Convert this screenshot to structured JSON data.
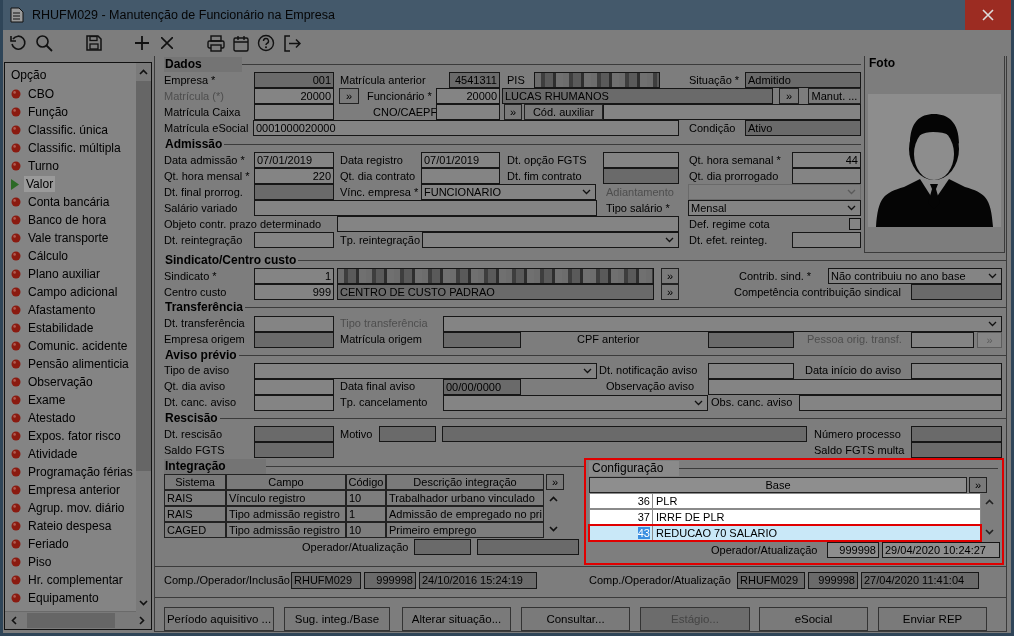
{
  "window": {
    "title": "RHUFM029 - Manutenção de Funcionário na Empresa"
  },
  "sidebar": {
    "title": "Opção",
    "items": [
      {
        "label": "CBO",
        "selected": false
      },
      {
        "label": "Função",
        "selected": false
      },
      {
        "label": "Classific. única",
        "selected": false
      },
      {
        "label": "Classific. múltipla",
        "selected": false
      },
      {
        "label": "Turno",
        "selected": false
      },
      {
        "label": "Valor",
        "selected": true
      },
      {
        "label": "Conta bancária",
        "selected": false
      },
      {
        "label": "Banco de hora",
        "selected": false
      },
      {
        "label": "Vale transporte",
        "selected": false
      },
      {
        "label": "Cálculo",
        "selected": false
      },
      {
        "label": "Plano auxiliar",
        "selected": false
      },
      {
        "label": "Campo adicional",
        "selected": false
      },
      {
        "label": "Afastamento",
        "selected": false
      },
      {
        "label": "Estabilidade",
        "selected": false
      },
      {
        "label": "Comunic. acidente",
        "selected": false
      },
      {
        "label": "Pensão alimenticia",
        "selected": false
      },
      {
        "label": "Observação",
        "selected": false
      },
      {
        "label": "Exame",
        "selected": false
      },
      {
        "label": "Atestado",
        "selected": false
      },
      {
        "label": "Expos. fator risco",
        "selected": false
      },
      {
        "label": "Atividade",
        "selected": false
      },
      {
        "label": "Programação férias",
        "selected": false
      },
      {
        "label": "Empresa anterior",
        "selected": false
      },
      {
        "label": "Agrup. mov. diário",
        "selected": false
      },
      {
        "label": "Rateio despesa",
        "selected": false
      },
      {
        "label": "Feriado",
        "selected": false
      },
      {
        "label": "Piso",
        "selected": false
      },
      {
        "label": "Hr. complementar",
        "selected": false
      },
      {
        "label": "Equipamento",
        "selected": false
      }
    ]
  },
  "sections": [
    {
      "title": "Dados",
      "lines": [
        {
          "items": [
            {
              "kind": "label",
              "text": "Empresa *",
              "disabled": false
            },
            {
              "kind": "number",
              "value": "001",
              "disabled": true
            },
            {
              "kind": "label",
              "text": "Matrícula anterior",
              "disabled": false
            },
            {
              "kind": "number",
              "value": "4541311",
              "disabled": true
            },
            {
              "kind": "label",
              "text": "PIS",
              "disabled": false
            },
            {
              "kind": "redacted"
            },
            {
              "kind": "label",
              "text": "Situação *",
              "disabled": false
            },
            {
              "kind": "field",
              "value": "Admitido",
              "disabled": true
            }
          ]
        },
        {
          "items": [
            {
              "kind": "label",
              "text": "Matrícula (*)",
              "disabled": true
            },
            {
              "kind": "number",
              "value": "20000",
              "disabled": false
            },
            {
              "kind": "button",
              "text": "»",
              "disabled": false
            },
            {
              "kind": "label",
              "text": "Funcionário *",
              "disabled": false
            },
            {
              "kind": "number",
              "value": "20000",
              "disabled": false
            },
            {
              "kind": "field",
              "value": "LUCAS RHUMANOS",
              "disabled": true
            },
            {
              "kind": "button",
              "text": "»",
              "disabled": false
            },
            {
              "kind": "button",
              "text": "Manut. ...",
              "disabled": false
            }
          ]
        },
        {
          "items": [
            {
              "kind": "label",
              "text": "Matrícula Caixa",
              "disabled": false
            },
            {
              "kind": "field",
              "disabled": false
            },
            {
              "kind": "label",
              "text": "CNO/CAEPF",
              "disabled": false
            },
            {
              "kind": "field",
              "disabled": false
            },
            {
              "kind": "button",
              "text": "»",
              "disabled": false
            },
            {
              "kind": "button",
              "text": "Cód. auxiliar",
              "disabled": false
            },
            {
              "kind": "field",
              "disabled": false
            }
          ]
        },
        {
          "items": [
            {
              "kind": "label",
              "text": "Matrícula eSocial",
              "disabled": false
            },
            {
              "kind": "field",
              "value": "0001000020000",
              "disabled": false
            },
            {
              "kind": "label",
              "text": "Condição",
              "disabled": false
            },
            {
              "kind": "field",
              "value": "Ativo",
              "disabled": true
            }
          ]
        }
      ]
    },
    {
      "title": "Admissão",
      "lines": [
        {
          "items": [
            {
              "kind": "label",
              "text": "Data admissão *",
              "disabled": false
            },
            {
              "kind": "field",
              "value": "07/01/2019",
              "disabled": false
            },
            {
              "kind": "label",
              "text": "Data registro",
              "disabled": false
            },
            {
              "kind": "field",
              "value": "07/01/2019",
              "disabled": false
            },
            {
              "kind": "label",
              "text": "Dt. opção FGTS",
              "disabled": false
            },
            {
              "kind": "field",
              "disabled": false
            },
            {
              "kind": "label",
              "text": "Qt. hora semanal *",
              "disabled": false
            },
            {
              "kind": "number",
              "value": "44",
              "disabled": false
            }
          ]
        },
        {
          "items": [
            {
              "kind": "label",
              "text": "Qt. hora mensal *",
              "disabled": false
            },
            {
              "kind": "number",
              "value": "220",
              "disabled": false
            },
            {
              "kind": "label",
              "text": "Qt. dia contrato",
              "disabled": false
            },
            {
              "kind": "field",
              "disabled": false
            },
            {
              "kind": "label",
              "text": "Dt. fim contrato",
              "disabled": false
            },
            {
              "kind": "field",
              "disabled": true
            },
            {
              "kind": "label",
              "text": "Qt. dia prorrogado",
              "disabled": false
            },
            {
              "kind": "field",
              "disabled": false
            }
          ]
        },
        {
          "items": [
            {
              "kind": "label",
              "text": "Dt. final prorrog.",
              "disabled": false
            },
            {
              "kind": "field",
              "disabled": true
            },
            {
              "kind": "label",
              "text": "Vínc. empresa *",
              "disabled": false
            },
            {
              "kind": "combo",
              "value": "FUNCIONARIO",
              "disabled": false
            },
            {
              "kind": "label",
              "text": "Adiantamento",
              "disabled": true
            },
            {
              "kind": "combo",
              "disabled": true
            }
          ]
        },
        {
          "items": [
            {
              "kind": "label",
              "text": "Salário variado",
              "disabled": false
            },
            {
              "kind": "field",
              "disabled": false
            },
            {
              "kind": "label",
              "text": "Tipo salário *",
              "disabled": false
            },
            {
              "kind": "combo",
              "value": "Mensal",
              "disabled": false
            }
          ]
        },
        {
          "items": [
            {
              "kind": "label",
              "text": "Objeto contr. prazo determinado",
              "disabled": false
            },
            {
              "kind": "field",
              "disabled": false
            },
            {
              "kind": "label",
              "text": "Def. regime cota",
              "disabled": false
            },
            {
              "kind": "checkbox",
              "checked": false
            }
          ]
        },
        {
          "items": [
            {
              "kind": "label",
              "text": "Dt. reintegração",
              "disabled": false
            },
            {
              "kind": "field",
              "disabled": false
            },
            {
              "kind": "label",
              "text": "Tp. reintegração",
              "disabled": false
            },
            {
              "kind": "combo",
              "disabled": false
            },
            {
              "kind": "label",
              "text": "Dt. efet. reinteg.",
              "disabled": false
            },
            {
              "kind": "field",
              "disabled": false
            }
          ]
        }
      ]
    },
    {
      "title": "Sindicato/Centro custo",
      "lines": [
        {
          "items": [
            {
              "kind": "label",
              "text": "Sindicato *",
              "disabled": false
            },
            {
              "kind": "number",
              "value": "1",
              "disabled": false
            },
            {
              "kind": "redacted"
            },
            {
              "kind": "button",
              "text": "»",
              "disabled": false
            },
            {
              "kind": "label",
              "text": "Contrib. sind. *",
              "disabled": false
            },
            {
              "kind": "combo",
              "value": "Não contribuiu no ano base",
              "disabled": false
            }
          ]
        },
        {
          "items": [
            {
              "kind": "label",
              "text": "Centro custo",
              "disabled": false
            },
            {
              "kind": "number",
              "value": "999",
              "disabled": false
            },
            {
              "kind": "field",
              "value": "CENTRO DE CUSTO PADRAO",
              "disabled": true
            },
            {
              "kind": "button",
              "text": "»",
              "disabled": false
            },
            {
              "kind": "label",
              "text": "Competência contribuição sindical",
              "disabled": false
            },
            {
              "kind": "field",
              "disabled": true
            }
          ]
        }
      ]
    },
    {
      "title": "Transferência",
      "lines": [
        {
          "items": [
            {
              "kind": "label",
              "text": "Dt. transferência",
              "disabled": false
            },
            {
              "kind": "field",
              "disabled": false
            },
            {
              "kind": "label",
              "text": "Tipo transferência",
              "disabled": true
            },
            {
              "kind": "combo",
              "disabled": false
            }
          ]
        },
        {
          "items": [
            {
              "kind": "label",
              "text": "Empresa origem",
              "disabled": false
            },
            {
              "kind": "field",
              "disabled": true
            },
            {
              "kind": "label",
              "text": "Matrícula origem",
              "disabled": false
            },
            {
              "kind": "field",
              "disabled": true
            },
            {
              "kind": "label",
              "text": "CPF anterior",
              "disabled": false
            },
            {
              "kind": "field",
              "disabled": true
            },
            {
              "kind": "label",
              "text": "Pessoa orig. transf.",
              "disabled": true
            },
            {
              "kind": "field",
              "disabled": false
            },
            {
              "kind": "button",
              "text": "»",
              "disabled": true
            }
          ]
        }
      ]
    },
    {
      "title": "Aviso prévio",
      "lines": [
        {
          "items": [
            {
              "kind": "label",
              "text": "Tipo de aviso",
              "disabled": false
            },
            {
              "kind": "combo",
              "disabled": false
            },
            {
              "kind": "label",
              "text": "Dt. notificação aviso",
              "disabled": false
            },
            {
              "kind": "field",
              "disabled": false
            },
            {
              "kind": "label",
              "text": "Data início do aviso",
              "disabled": false
            },
            {
              "kind": "field",
              "disabled": false
            }
          ]
        },
        {
          "items": [
            {
              "kind": "label",
              "text": "Qt. dia aviso",
              "disabled": false
            },
            {
              "kind": "field",
              "disabled": false
            },
            {
              "kind": "label",
              "text": "Data final aviso",
              "disabled": false
            },
            {
              "kind": "field",
              "value": "00/00/0000",
              "disabled": true
            },
            {
              "kind": "label",
              "text": "Observação aviso",
              "disabled": false
            },
            {
              "kind": "field",
              "disabled": false
            }
          ]
        },
        {
          "items": [
            {
              "kind": "label",
              "text": "Dt. canc. aviso",
              "disabled": false
            },
            {
              "kind": "field",
              "disabled": false
            },
            {
              "kind": "label",
              "text": "Tp. cancelamento",
              "disabled": false
            },
            {
              "kind": "combo",
              "disabled": false
            },
            {
              "kind": "label",
              "text": "Obs. canc. aviso",
              "disabled": false
            },
            {
              "kind": "field",
              "disabled": false
            }
          ]
        }
      ]
    },
    {
      "title": "Rescisão",
      "lines": [
        {
          "items": [
            {
              "kind": "label",
              "text": "Dt. rescisão",
              "disabled": false
            },
            {
              "kind": "field",
              "disabled": true
            },
            {
              "kind": "label",
              "text": "Motivo",
              "disabled": false
            },
            {
              "kind": "field",
              "disabled": true
            },
            {
              "kind": "field",
              "disabled": true
            },
            {
              "kind": "label",
              "text": "Número processo",
              "disabled": false
            },
            {
              "kind": "field",
              "disabled": true
            }
          ]
        },
        {
          "items": [
            {
              "kind": "label",
              "text": "Saldo FGTS",
              "disabled": false
            },
            {
              "kind": "field",
              "disabled": true
            },
            {
              "kind": "label",
              "text": "Saldo FGTS multa",
              "disabled": false
            },
            {
              "kind": "field",
              "disabled": true
            }
          ]
        }
      ]
    }
  ],
  "photo": {
    "title": "Foto"
  },
  "integration": {
    "title": "Integração",
    "columns": [
      "Sistema",
      "Campo",
      "Código",
      "Descrição integração"
    ],
    "more_button": "»",
    "rows": [
      [
        "RAIS",
        "Vínculo registro",
        "10",
        "Trabalhador urbano vinculado"
      ],
      [
        "RAIS",
        "Tipo admissão registro",
        "1",
        "Admissão de empregado no pri"
      ],
      [
        "CAGED",
        "Tipo admissão registro",
        "10",
        "Primeiro emprego"
      ]
    ],
    "operator_label": "Operador/Atualização"
  },
  "configuration": {
    "title": "Configuração",
    "column": "Base",
    "more_button": "»",
    "rows": [
      {
        "code": "36",
        "name": "PLR",
        "selected": false
      },
      {
        "code": "37",
        "name": "IRRF DE PLR",
        "selected": false
      },
      {
        "code": "43",
        "name": "REDUCAO 70 SALARIO",
        "selected": true
      }
    ],
    "operator_label": "Operador/Atualização",
    "operator": "999998",
    "updated": "29/04/2020 10:24:27"
  },
  "inclusion": {
    "label": "Comp./Operador/Inclusão",
    "program": "RHUFM029",
    "operator": "999998",
    "timestamp": "24/10/2016 15:24:19"
  },
  "update": {
    "label": "Comp./Operador/Atualização",
    "program": "RHUFM029",
    "operator": "999998",
    "timestamp": "27/04/2020 11:41:04"
  },
  "buttons": [
    {
      "label": "Período aquisitivo ...",
      "disabled": false
    },
    {
      "label": "Sug. integ./Base",
      "disabled": false
    },
    {
      "label": "Alterar situação...",
      "disabled": false
    },
    {
      "label": "Consultar...",
      "disabled": false
    },
    {
      "label": "Estágio...",
      "disabled": true
    },
    {
      "label": "eSocial",
      "disabled": false
    },
    {
      "label": "Enviar REP",
      "disabled": false
    }
  ]
}
